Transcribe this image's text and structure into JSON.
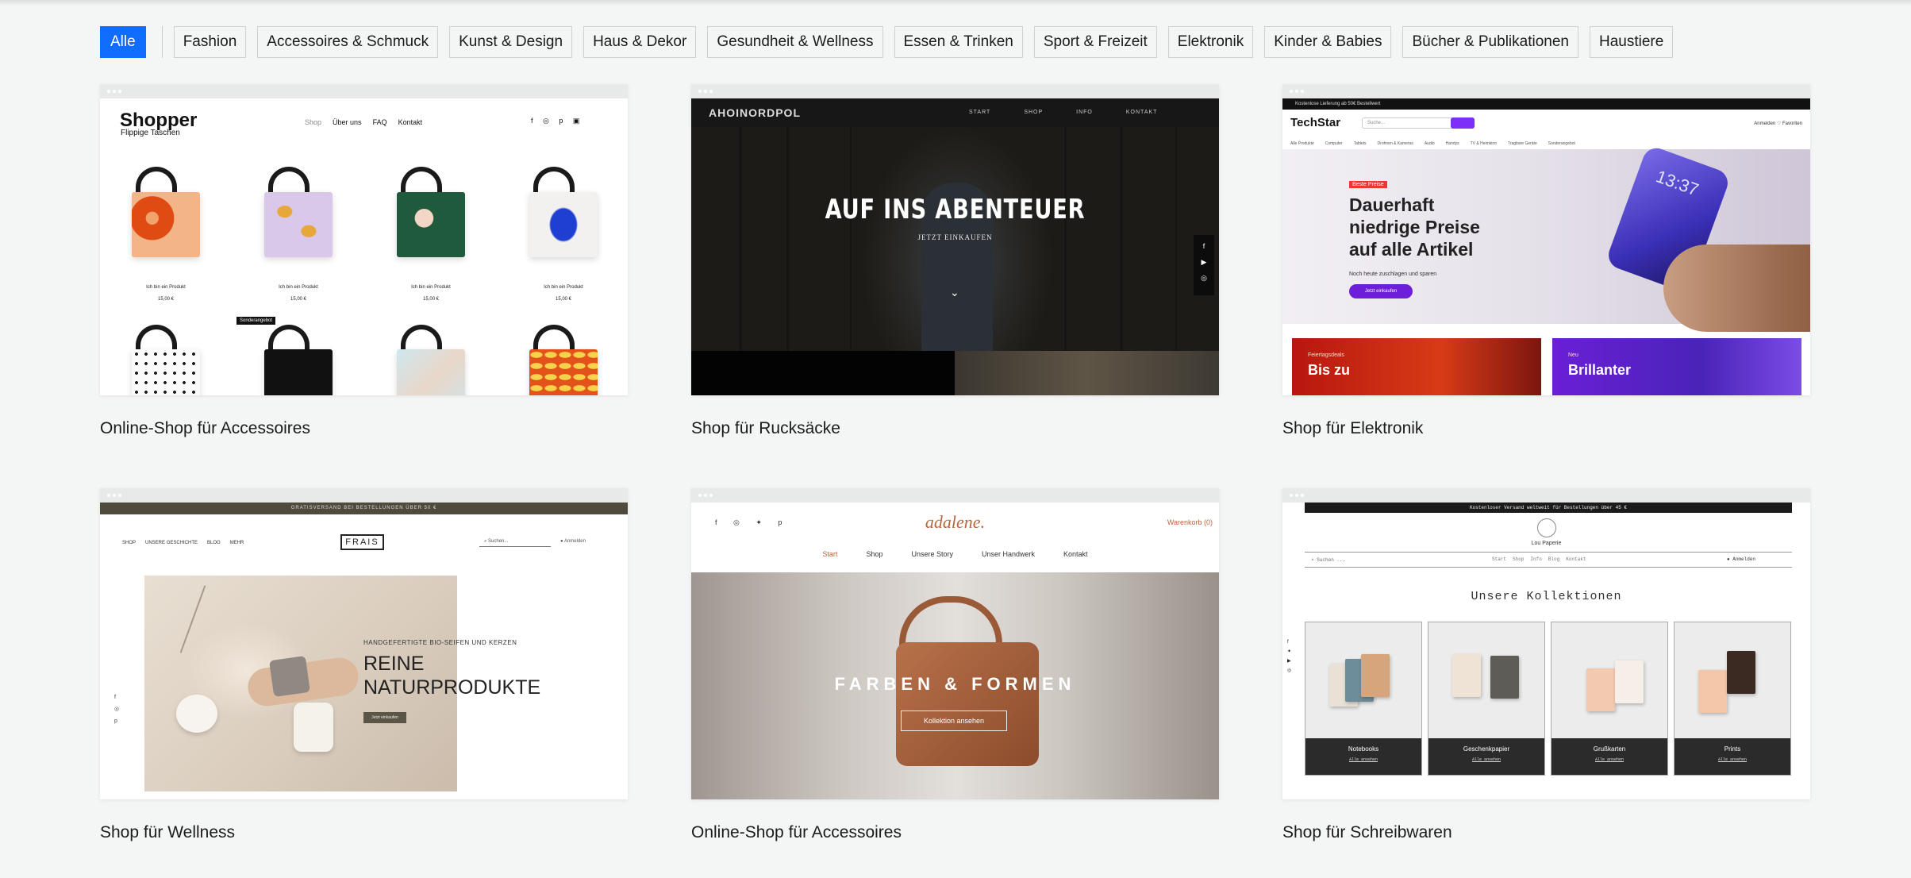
{
  "filters": {
    "active": "Alle",
    "items": [
      "Fashion",
      "Accessoires & Schmuck",
      "Kunst & Design",
      "Haus & Dekor",
      "Gesundheit & Wellness",
      "Essen & Trinken",
      "Sport & Freizeit",
      "Elektronik",
      "Kinder & Babies",
      "Bücher & Publikationen",
      "Haustiere"
    ]
  },
  "colors": {
    "accent": "#116dff",
    "background": "#f4f5f5"
  },
  "cards": [
    {
      "caption": "Online-Shop für Accessoires",
      "preview": {
        "logo": "Shopper",
        "tagline": "Flippige Taschen",
        "nav": [
          "Shop",
          "Über uns",
          "FAQ",
          "Kontakt"
        ],
        "icons": "f ◎ p ▣",
        "product_name": "Ich bin ein Produkt",
        "product_price": "15,00 €",
        "sale_badge": "Sonderangebot"
      }
    },
    {
      "caption": "Shop für Rucksäcke",
      "preview": {
        "logo": "AHOINORDPOL",
        "nav": [
          "START",
          "SHOP",
          "INFO",
          "KONTAKT"
        ],
        "title": "AUF INS ABENTEUER",
        "subtitle": "JETZT EINKAUFEN",
        "social": "f\n▶\n◎"
      }
    },
    {
      "caption": "Shop für Elektronik",
      "preview": {
        "topbar": "Kostenlose Lieferung ab 50€ Bestellwert",
        "logo": "TechStar",
        "search": "Suche...",
        "account": "Anmelden  ♡ Favoriten",
        "categories": [
          "Alle Produkte",
          "Computer",
          "Tablets",
          "Drohnen & Kameras",
          "Audio",
          "Handys",
          "TV & Heimkino",
          "Tragbare Geräte",
          "Sonderangebot"
        ],
        "tag": "Beste Preise",
        "headline_1": "Dauerhaft",
        "headline_2": "niedrige Preise",
        "headline_3": "auf alle Artikel",
        "note": "Noch heute zuschlagen und sparen",
        "button": "Jetzt einkaufen",
        "time": "13:37",
        "promo_1_kicker": "Feiertagsdeals",
        "promo_1_title": "Bis zu",
        "promo_2_kicker": "Neu",
        "promo_2_title": "Brillanter"
      }
    },
    {
      "caption": "Shop für Wellness",
      "preview": {
        "topbar": "GRATISVERSAND BEI BESTELLUNGEN ÜBER 50 €",
        "nav": [
          "SHOP",
          "UNSERE GESCHICHTE",
          "BLOG",
          "MEHR"
        ],
        "logo": "FRAIS",
        "search": "⌕ Suchen...",
        "login": "● Anmelden",
        "kicker": "HANDGEFERTIGTE BIO-SEIFEN UND KERZEN",
        "headline_1": "REINE",
        "headline_2": "NATURPRODUKTE",
        "button": "Jetzt einkaufen",
        "social": "f\n◎\np"
      }
    },
    {
      "caption": "Online-Shop für Accessoires",
      "preview": {
        "social": "f ◎ ✦ p",
        "logo": "adalene.",
        "cart": "Warenkorb (0)",
        "nav": [
          "Start",
          "Shop",
          "Unsere Story",
          "Unser Handwerk",
          "Kontakt"
        ],
        "title": "FARBEN & FORMEN",
        "button": "Kollektion ansehen"
      }
    },
    {
      "caption": "Shop für Schreibwaren",
      "preview": {
        "topbar": "Kostenloser Versand weltweit für Bestellungen über 45 €",
        "brand": "Lou Paperie",
        "search": "⌕ Suchen ...",
        "nav": [
          "Start",
          "Shop",
          "Info",
          "Blog",
          "Kontakt"
        ],
        "account": "● Anmelden",
        "title": "Unsere Kollektionen",
        "collections": [
          {
            "name": "Notebooks",
            "link": "Alle ansehen"
          },
          {
            "name": "Geschenkpapier",
            "link": "Alle ansehen"
          },
          {
            "name": "Grußkarten",
            "link": "Alle ansehen"
          },
          {
            "name": "Prints",
            "link": "Alle ansehen"
          }
        ],
        "social": "f\n✦\n▶\n◎"
      }
    }
  ]
}
